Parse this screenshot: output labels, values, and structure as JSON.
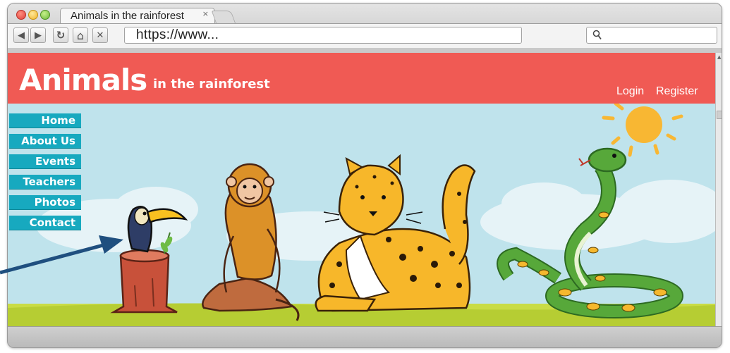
{
  "browser": {
    "tab_title": "Animals in the rainforest",
    "tab_close": "×",
    "address": "https://www...",
    "nav": {
      "back": "◀",
      "forward": "▶",
      "reload": "↻",
      "home": "⌂",
      "stop": "✕"
    }
  },
  "site": {
    "title": "Animals",
    "subtitle": "in the rainforest",
    "login": "Login",
    "register": "Register",
    "menu": [
      "Home",
      "About Us",
      "Events",
      "Teachers",
      "Photos",
      "Contact"
    ]
  },
  "colors": {
    "header": "#f05a54",
    "menu": "#17a9bf",
    "sky": "#bfe3ec",
    "grass": "#c9dc45"
  },
  "icons": [
    "back-icon",
    "forward-icon",
    "reload-icon",
    "home-icon",
    "stop-icon",
    "search-icon"
  ]
}
